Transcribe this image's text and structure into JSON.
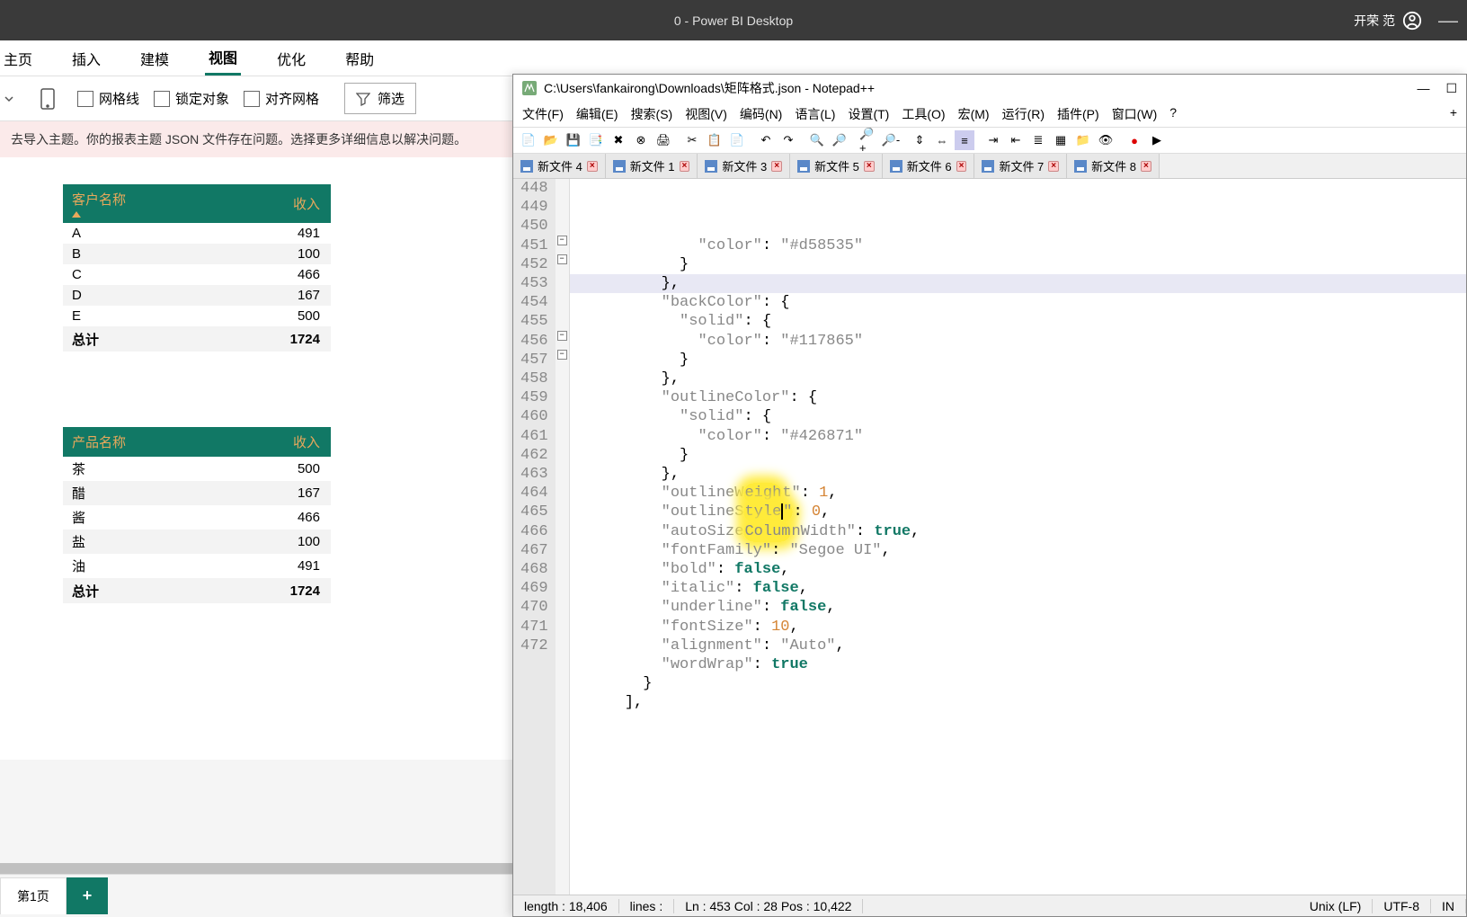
{
  "powerbi": {
    "title": "0 - Power BI Desktop",
    "user": "开荣 范",
    "ribbon_tabs": [
      "主页",
      "插入",
      "建模",
      "视图",
      "优化",
      "帮助"
    ],
    "active_tab": "视图",
    "toolbar": {
      "grid_lines": "网格线",
      "lock_objects": "锁定对象",
      "align_grid": "对齐网格",
      "filter": "筛选"
    },
    "notification": "去导入主题。你的报表主题 JSON 文件存在问题。选择更多详细信息以解决问题。",
    "table1": {
      "headers": [
        "客户名称",
        "收入"
      ],
      "rows": [
        {
          "name": "A",
          "value": "491"
        },
        {
          "name": "B",
          "value": "100"
        },
        {
          "name": "C",
          "value": "466"
        },
        {
          "name": "D",
          "value": "167"
        },
        {
          "name": "E",
          "value": "500"
        }
      ],
      "total_label": "总计",
      "total_value": "1724"
    },
    "table2": {
      "headers": [
        "产品名称",
        "收入"
      ],
      "rows": [
        {
          "name": "茶",
          "value": "500"
        },
        {
          "name": "醋",
          "value": "167"
        },
        {
          "name": "酱",
          "value": "466"
        },
        {
          "name": "盐",
          "value": "100"
        },
        {
          "name": "油",
          "value": "491"
        }
      ],
      "total_label": "总计",
      "total_value": "1724"
    },
    "page_tab": "第1页"
  },
  "notepad": {
    "title": "C:\\Users\\fankairong\\Downloads\\矩阵格式.json - Notepad++",
    "menus": [
      "文件(F)",
      "编辑(E)",
      "搜索(S)",
      "视图(V)",
      "编码(N)",
      "语言(L)",
      "设置(T)",
      "工具(O)",
      "宏(M)",
      "运行(R)",
      "插件(P)",
      "窗口(W)",
      "?"
    ],
    "tabs": [
      "新文件 4",
      "新文件 1",
      "新文件 3",
      "新文件 5",
      "新文件 6",
      "新文件 7",
      "新文件 8"
    ],
    "line_start": 448,
    "line_end": 472,
    "highlighted_line": 453,
    "json_content": {
      "color1": "#d58535",
      "backColor_solid_color": "#117865",
      "outlineColor_solid_color": "#426871",
      "outlineWeight": 1,
      "outlineStyle": 0,
      "autoSizeColumnWidth": true,
      "fontFamily": "Segoe UI",
      "bold": false,
      "italic": false,
      "underline": false,
      "fontSize": 10,
      "alignment": "Auto",
      "wordWrap": true
    },
    "status": {
      "length": "length : 18,406",
      "lines": "lines :",
      "pos": "Ln : 453    Col : 28    Pos : 10,422",
      "eol": "Unix (LF)",
      "encoding": "UTF-8",
      "mode": "IN"
    }
  }
}
